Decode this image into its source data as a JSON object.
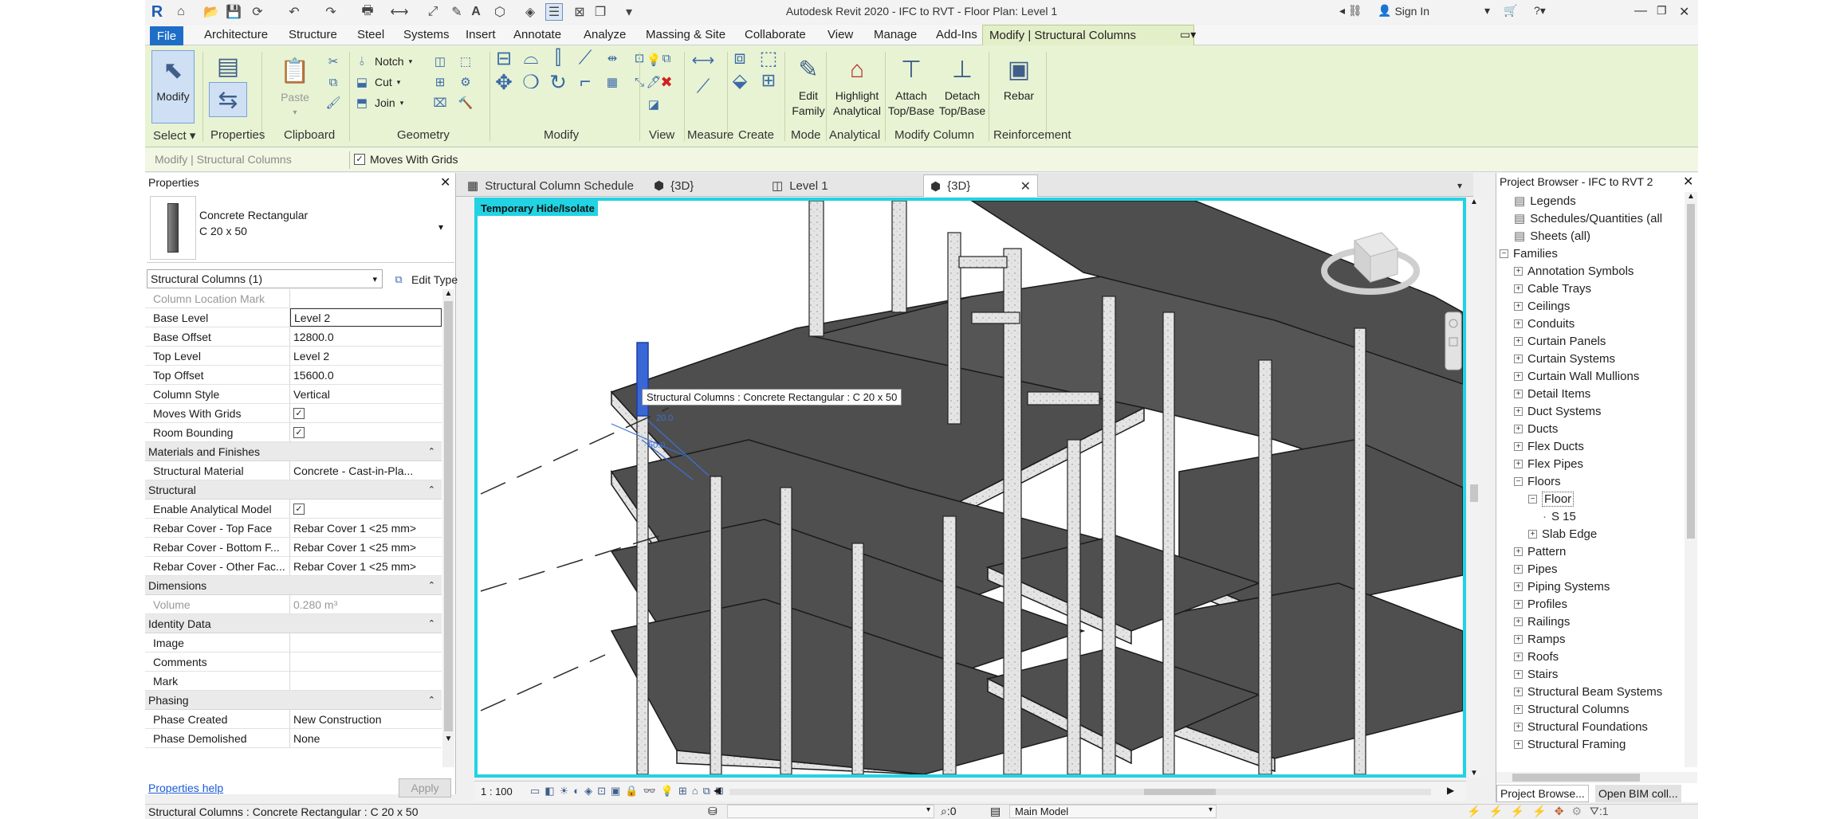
{
  "app": {
    "title": "Autodesk Revit 2020 - IFC to RVT - Floor Plan: Level 1",
    "sign_in": "Sign In"
  },
  "menu": {
    "file": "File",
    "tabs": [
      "Architecture",
      "Structure",
      "Steel",
      "Systems",
      "Insert",
      "Annotate",
      "Analyze",
      "Massing & Site",
      "Collaborate",
      "View",
      "Manage",
      "Add-Ins"
    ],
    "active_tab": "Modify | Structural Columns"
  },
  "ribbon": {
    "modify_label": "Modify",
    "paste_label": "Paste",
    "notch": "Notch",
    "cut": "Cut",
    "join": "Join",
    "edit_family": "Edit\nFamily",
    "highlight_analytical": "Highlight\nAnalytical",
    "attach": "Attach\nTop/Base",
    "detach": "Detach\nTop/Base",
    "rebar": "Rebar",
    "panels": [
      "Select",
      "Properties",
      "Clipboard",
      "Geometry",
      "Modify",
      "View",
      "Measure",
      "Create",
      "Mode",
      "Analytical",
      "Modify Column",
      "Reinforcement"
    ]
  },
  "options_bar": {
    "context": "Modify | Structural Columns",
    "moves_with_grids": "Moves With Grids"
  },
  "properties": {
    "header": "Properties",
    "type_name": "Concrete Rectangular",
    "type_size": "C 20 x 50",
    "selector": "Structural Columns (1)",
    "edit_type": "Edit Type",
    "rows": [
      {
        "kind": "prop",
        "name": "Column Location Mark",
        "value": "",
        "disabled": true
      },
      {
        "kind": "prop",
        "name": "Base Level",
        "value": "Level 2",
        "editing": true
      },
      {
        "kind": "prop",
        "name": "Base Offset",
        "value": "12800.0"
      },
      {
        "kind": "prop",
        "name": "Top Level",
        "value": "Level 2"
      },
      {
        "kind": "prop",
        "name": "Top Offset",
        "value": "15600.0"
      },
      {
        "kind": "prop",
        "name": "Column Style",
        "value": "Vertical"
      },
      {
        "kind": "check",
        "name": "Moves With Grids",
        "value": "✓"
      },
      {
        "kind": "check",
        "name": "Room Bounding",
        "value": "✓"
      },
      {
        "kind": "section",
        "name": "Materials and Finishes"
      },
      {
        "kind": "prop",
        "name": "Structural Material",
        "value": "Concrete - Cast-in-Pla..."
      },
      {
        "kind": "section",
        "name": "Structural"
      },
      {
        "kind": "check",
        "name": "Enable Analytical Model",
        "value": "✓"
      },
      {
        "kind": "prop",
        "name": "Rebar Cover - Top Face",
        "value": "Rebar Cover 1 <25 mm>"
      },
      {
        "kind": "prop",
        "name": "Rebar Cover - Bottom F...",
        "value": "Rebar Cover 1 <25 mm>"
      },
      {
        "kind": "prop",
        "name": "Rebar Cover - Other Fac...",
        "value": "Rebar Cover 1 <25 mm>"
      },
      {
        "kind": "section",
        "name": "Dimensions"
      },
      {
        "kind": "prop",
        "name": "Volume",
        "value": "0.280 m³",
        "disabled": true
      },
      {
        "kind": "section",
        "name": "Identity Data"
      },
      {
        "kind": "prop",
        "name": "Image",
        "value": ""
      },
      {
        "kind": "prop",
        "name": "Comments",
        "value": ""
      },
      {
        "kind": "prop",
        "name": "Mark",
        "value": ""
      },
      {
        "kind": "section",
        "name": "Phasing"
      },
      {
        "kind": "prop",
        "name": "Phase Created",
        "value": "New Construction"
      },
      {
        "kind": "prop",
        "name": "Phase Demolished",
        "value": "None"
      }
    ],
    "help": "Properties help",
    "apply": "Apply"
  },
  "view_tabs": [
    "Structural Column Schedule",
    "{3D}",
    "Level 1",
    "{3D}"
  ],
  "canvas": {
    "temp_hide": "Temporary Hide/Isolate",
    "tooltip": "Structural Columns : Concrete Rectangular : C 20 x 50",
    "scale": "1 : 100"
  },
  "browser": {
    "header": "Project Browser - IFC to RVT 2",
    "items": [
      {
        "label": "Legends",
        "level": 1,
        "kind": "leaf"
      },
      {
        "label": "Schedules/Quantities (all",
        "level": 1,
        "kind": "leaf"
      },
      {
        "label": "Sheets (all)",
        "level": 1,
        "kind": "leaf"
      },
      {
        "label": "Families",
        "level": 0,
        "kind": "open"
      },
      {
        "label": "Annotation Symbols",
        "level": 1,
        "kind": "closed"
      },
      {
        "label": "Cable Trays",
        "level": 1,
        "kind": "closed"
      },
      {
        "label": "Ceilings",
        "level": 1,
        "kind": "closed"
      },
      {
        "label": "Conduits",
        "level": 1,
        "kind": "closed"
      },
      {
        "label": "Curtain Panels",
        "level": 1,
        "kind": "closed"
      },
      {
        "label": "Curtain Systems",
        "level": 1,
        "kind": "closed"
      },
      {
        "label": "Curtain Wall Mullions",
        "level": 1,
        "kind": "closed"
      },
      {
        "label": "Detail Items",
        "level": 1,
        "kind": "closed"
      },
      {
        "label": "Duct Systems",
        "level": 1,
        "kind": "closed"
      },
      {
        "label": "Ducts",
        "level": 1,
        "kind": "closed"
      },
      {
        "label": "Flex Ducts",
        "level": 1,
        "kind": "closed"
      },
      {
        "label": "Flex Pipes",
        "level": 1,
        "kind": "closed"
      },
      {
        "label": "Floors",
        "level": 1,
        "kind": "open"
      },
      {
        "label": "Floor",
        "level": 2,
        "kind": "open",
        "selected": true
      },
      {
        "label": "S 15",
        "level": 3,
        "kind": "leaf"
      },
      {
        "label": "Slab Edge",
        "level": 2,
        "kind": "closed"
      },
      {
        "label": "Pattern",
        "level": 1,
        "kind": "closed"
      },
      {
        "label": "Pipes",
        "level": 1,
        "kind": "closed"
      },
      {
        "label": "Piping Systems",
        "level": 1,
        "kind": "closed"
      },
      {
        "label": "Profiles",
        "level": 1,
        "kind": "closed"
      },
      {
        "label": "Railings",
        "level": 1,
        "kind": "closed"
      },
      {
        "label": "Ramps",
        "level": 1,
        "kind": "closed"
      },
      {
        "label": "Roofs",
        "level": 1,
        "kind": "closed"
      },
      {
        "label": "Stairs",
        "level": 1,
        "kind": "closed"
      },
      {
        "label": "Structural Beam Systems",
        "level": 1,
        "kind": "closed"
      },
      {
        "label": "Structural Columns",
        "level": 1,
        "kind": "closed"
      },
      {
        "label": "Structural Foundations",
        "level": 1,
        "kind": "closed"
      },
      {
        "label": "Structural Framing",
        "level": 1,
        "kind": "closed"
      }
    ],
    "bottom_tabs": [
      "Project Browse...",
      "Open BIM coll..."
    ]
  },
  "status": {
    "text": "Structural Columns : Concrete Rectangular : C 20 x 50",
    "zero": ":0",
    "model": "Main Model",
    "filter": ":1"
  }
}
